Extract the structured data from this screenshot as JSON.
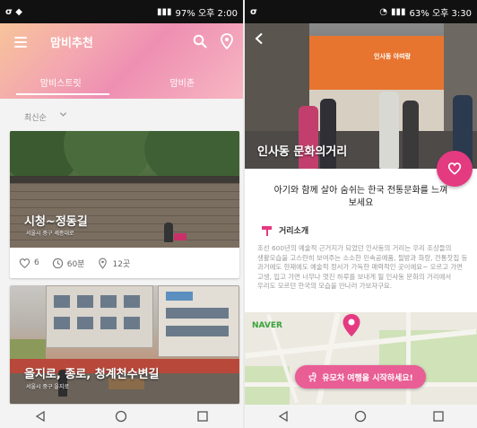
{
  "left": {
    "statusbar": {
      "left_icons": "σ ◆",
      "right": "97% 오후 2:00"
    },
    "appbar": {
      "title": "맘비추천"
    },
    "tabs": [
      {
        "label": "맘비스트릿",
        "active": true
      },
      {
        "label": "맘비존",
        "active": false
      }
    ],
    "sort": {
      "label": "최신순"
    },
    "cards": [
      {
        "title": "시청~정동길",
        "subtitle": "서울시 중구 세종대로",
        "likes": "6",
        "duration": "60분",
        "places": "12곳"
      },
      {
        "title": "을지로, 종로, 청계천수변길",
        "subtitle": "서울시 중구 을지로"
      }
    ],
    "icons": {
      "menu": "menu-icon",
      "search": "search-icon",
      "location": "location-pin-icon",
      "heart": "heart-outline-icon",
      "clock": "clock-icon",
      "pin": "pin-outline-icon"
    }
  },
  "right": {
    "statusbar": {
      "left_icons": "σ",
      "right": "63% 오후 3:30"
    },
    "hero": {
      "title": "인사동 문화의거리",
      "shop_sign": "인사동 아띠랑"
    },
    "tagline": "아기와 함께 살아 숨쉬는 한국 전통문화를 느껴보세요",
    "section": {
      "title": "거리소개"
    },
    "description": "조선 600년의 예술적 근거지가 되었던 인사동의 거리는 우리 조상들의 생활모습을 고스란히 보여주는 소소한 민속공예품, 필방과 화랑, 전통찻집 등 과거에도 현재에도 예술적 정서가 가득한 매력적인 곳이에요~ 오르고 가면 고생, 입고 가면 너무나 멋진 하루를 보내게 될 인사동 문화의 거리에서 우리도 모르던 한국의 모습을 만나러 가보자구요.",
    "map": {
      "brand": "NAVER"
    },
    "cta": {
      "label": "유모차 여행을 시작하세요!"
    }
  },
  "colors": {
    "accent_pink": "#e43a80",
    "cta_pink": "#e95e95",
    "shop_orange": "#e8752f"
  }
}
